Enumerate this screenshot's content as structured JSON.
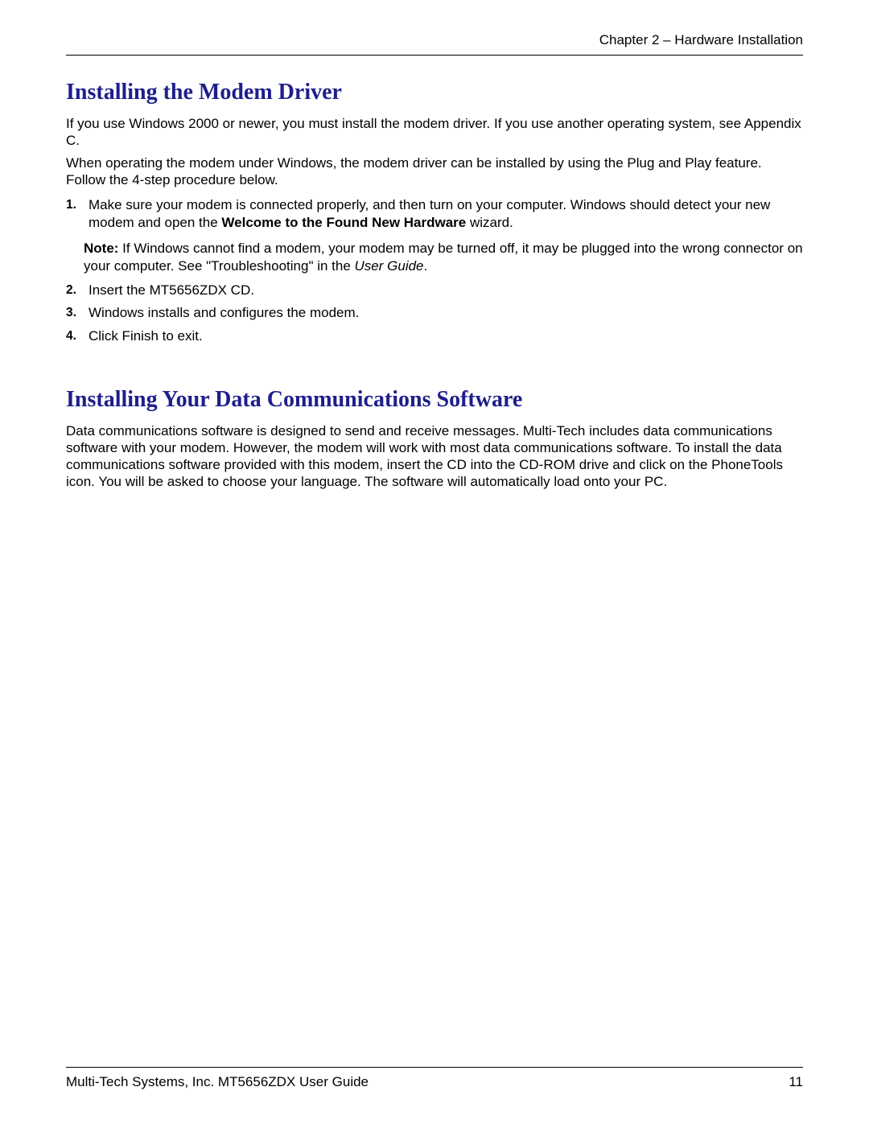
{
  "header": {
    "chapter": "Chapter 2 – Hardware Installation"
  },
  "section1": {
    "heading": "Installing the Modem Driver",
    "para1": "If you use Windows 2000 or newer, you must install the modem driver. If you use another operating system, see Appendix C.",
    "para2": "When operating the modem under Windows, the modem driver can be installed by using the Plug and Play feature. Follow the 4-step procedure below.",
    "list": [
      {
        "num": "1.",
        "text_before": "Make sure your modem is connected properly, and then turn on your computer. Windows should detect your new modem and open the ",
        "bold_text": "Welcome to the Found New Hardware",
        "text_after": " wizard."
      },
      {
        "num": "2.",
        "text": "Insert the MT5656ZDX CD."
      },
      {
        "num": "3.",
        "text": "Windows installs and configures the modem."
      },
      {
        "num": "4.",
        "text": "Click Finish to exit."
      }
    ],
    "note": {
      "label": "Note:",
      "text_before": " If Windows cannot find a modem, your modem may be turned off, it may be plugged into the wrong connector on your computer. See \"Troubleshooting\" in the ",
      "italic_text": "User Guide",
      "text_after": "."
    }
  },
  "section2": {
    "heading": "Installing Your Data Communications Software",
    "para1": "Data communications software is designed to send and receive messages. Multi-Tech includes data communications software with your modem. However, the modem will work with most data communications software. To install the data communications software provided with this modem, insert the CD into the CD-ROM drive and click on the PhoneTools icon. You will be asked to choose your language. The software will automatically load onto your PC."
  },
  "footer": {
    "left": "Multi-Tech Systems, Inc. MT5656ZDX User Guide",
    "right": "11"
  }
}
